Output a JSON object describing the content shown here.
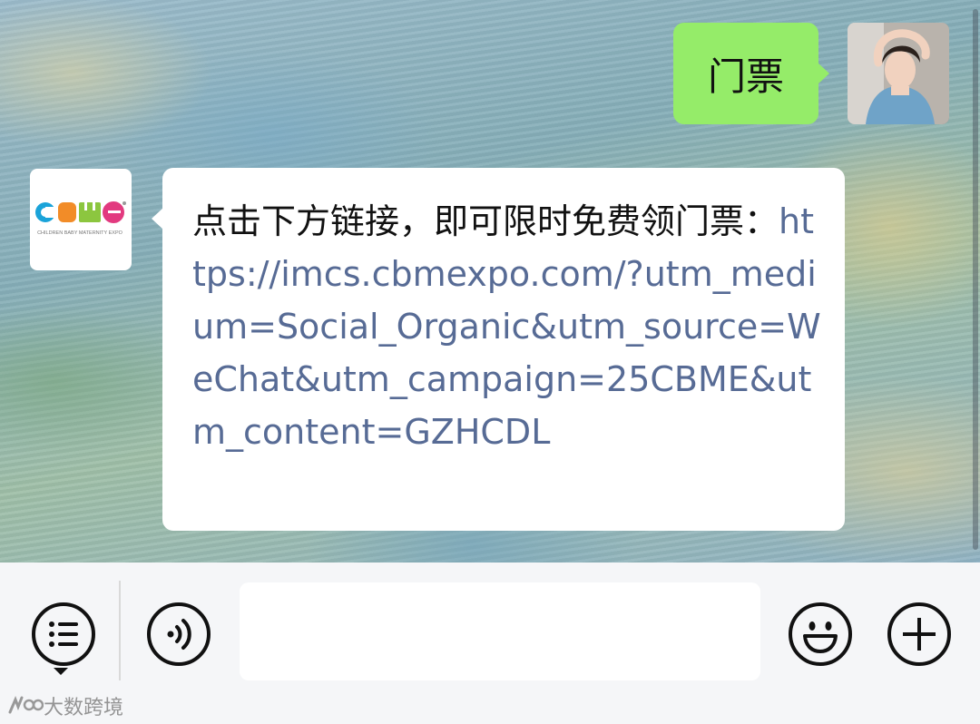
{
  "chat": {
    "messages": [
      {
        "side": "outgoing",
        "text": "门票"
      },
      {
        "side": "incoming",
        "text": "点击下方链接，即可限时免费领门票：",
        "link": "https://imcs.cbmexpo.com/?utm_medium=Social_Organic&utm_source=WeChat&utm_campaign=25CBME&utm_content=GZHCDL"
      }
    ]
  },
  "contact": {
    "logo_text": "CBME",
    "logo_subtext": "CHILDREN BABY MATERNITY EXPO"
  },
  "input_bar": {
    "left_icons": [
      "menu-icon",
      "voice-icon"
    ],
    "right_icons": [
      "emoji-icon",
      "plus-icon"
    ],
    "input_value": ""
  },
  "watermark": {
    "text": "大数跨境"
  },
  "colors": {
    "outgoing_bubble": "#95ec69",
    "incoming_bubble": "#ffffff",
    "link": "#576b95",
    "input_bar_bg": "#f5f6f8"
  }
}
